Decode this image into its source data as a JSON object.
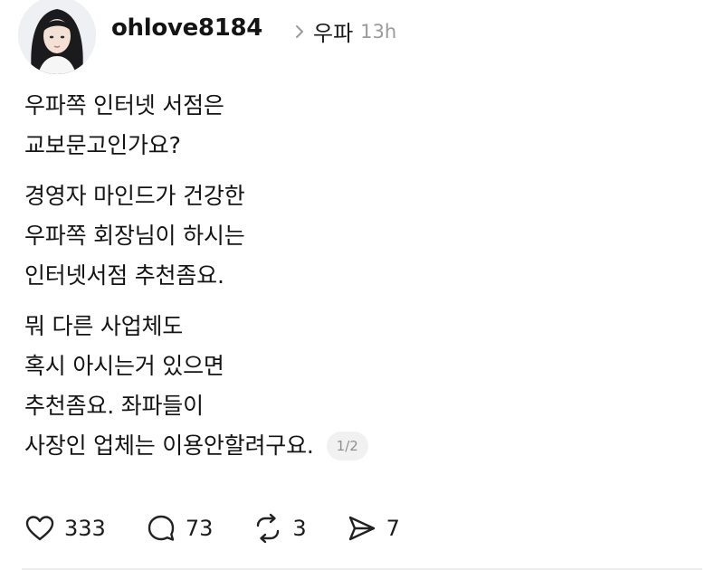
{
  "author": {
    "username": "ohlove8184",
    "avatar_icon": "profile-photo"
  },
  "community": {
    "name": "우파",
    "time_ago": "13h"
  },
  "post": {
    "paragraphs": [
      [
        "우파쪽 인터넷 서점은",
        "교보문고인가요?"
      ],
      [
        "경영자 마인드가 건강한",
        "우파쪽 회장님이 하시는",
        "인터넷서점 추천좀요."
      ],
      [
        "뭐 다른 사업체도",
        "혹시 아시는거 있으면",
        "추천좀요. 좌파들이",
        "사장인 업체는 이용안할려구요."
      ]
    ],
    "page_indicator": "1/2"
  },
  "actions": {
    "likes": "333",
    "comments": "73",
    "reposts": "3",
    "shares": "7"
  }
}
